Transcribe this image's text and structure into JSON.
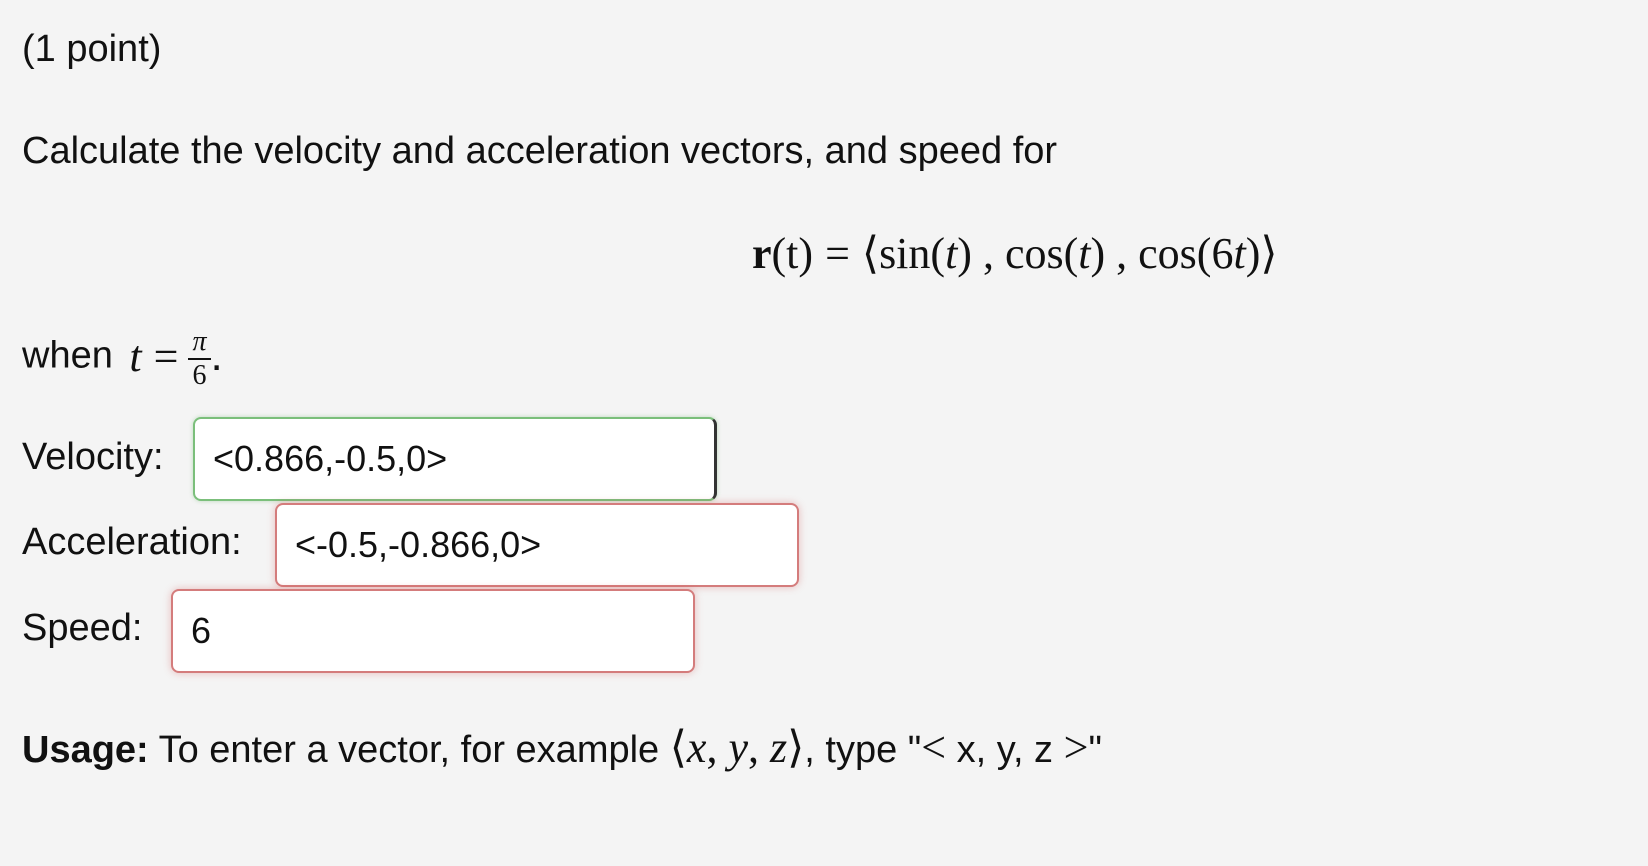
{
  "problem": {
    "points": "(1 point)",
    "prompt": "Calculate the velocity and acceleration vectors, and speed for",
    "formula": {
      "lhs_func": "r",
      "lhs_arg": "(t)",
      "equals": "=",
      "open": "⟨",
      "c1_fn": "sin(",
      "c1_var": "t",
      "c1_close": ")",
      "sep1": " , ",
      "c2_fn": "cos(",
      "c2_var": "t",
      "c2_close": ")",
      "sep2": " , ",
      "c3_fn": "cos(6",
      "c3_var": "t",
      "c3_close": ")",
      "close": "⟩"
    },
    "when": {
      "word": "when",
      "var": "t",
      "equals": "=",
      "numerator": "π",
      "denominator": "6",
      "period": "."
    }
  },
  "fields": {
    "velocity": {
      "label": "Velocity:",
      "value": "<0.866,-0.5,0>",
      "status": "correct"
    },
    "acceleration": {
      "label": "Acceleration:",
      "value": "<-0.5,-0.866,0>",
      "status": "incorrect"
    },
    "speed": {
      "label": "Speed:",
      "value": "6",
      "status": "incorrect"
    }
  },
  "usage": {
    "label": "Usage:",
    "text_before": " To enter a vector, for example ",
    "open": "⟨",
    "x": "x",
    "comma1": ", ",
    "y": "y",
    "comma2": ", ",
    "z": "z",
    "close": "⟩",
    "text_mid": ", type \"",
    "lt": "<",
    "example_inner": " x, y, z ",
    "gt": ">",
    "text_end": "\""
  },
  "colors": {
    "background": "#f4f4f4",
    "correct_border": "#7bbf7b",
    "incorrect_border": "#d47c7c",
    "text": "#111111"
  }
}
